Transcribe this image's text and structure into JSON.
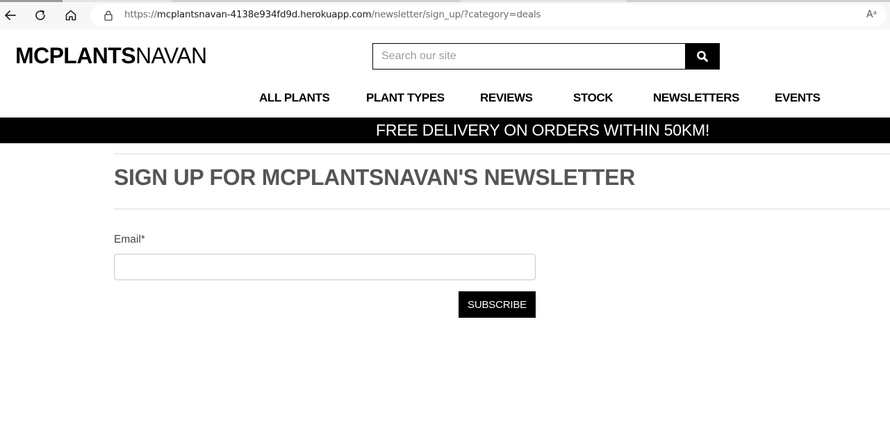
{
  "browser": {
    "url_scheme": "https://",
    "url_host": "mcplantsnavan-4138e934fd9d.herokuapp.com",
    "url_path": "/newsletter/sign_up/?category=deals",
    "icons": [
      "back-arrow-icon",
      "refresh-icon",
      "home-icon",
      "lock-icon",
      "read-aloud-icon"
    ],
    "read_aloud_glyph": "Aᵃ"
  },
  "header": {
    "logo_bold": "MCPLANTS",
    "logo_regular": "NAVAN",
    "search_placeholder": "Search our site",
    "search_icon": "magnifier-icon"
  },
  "nav": {
    "items": [
      {
        "label": "ALL PLANTS"
      },
      {
        "label": "PLANT TYPES"
      },
      {
        "label": "REVIEWS"
      },
      {
        "label": "STOCK"
      },
      {
        "label": "NEWSLETTERS"
      },
      {
        "label": "EVENTS"
      }
    ]
  },
  "banner": {
    "text": "FREE DELIVERY ON ORDERS WITHIN 50KM!"
  },
  "main": {
    "heading": "SIGN UP FOR MCPLANTSNAVAN'S NEWSLETTER",
    "email_label": "Email*",
    "email_value": "",
    "subscribe_label": "SUBSCRIBE"
  },
  "colors": {
    "banner_bg": "#000000",
    "banner_text": "#ffffff",
    "heading_text": "#555555",
    "button_bg": "#000000"
  }
}
